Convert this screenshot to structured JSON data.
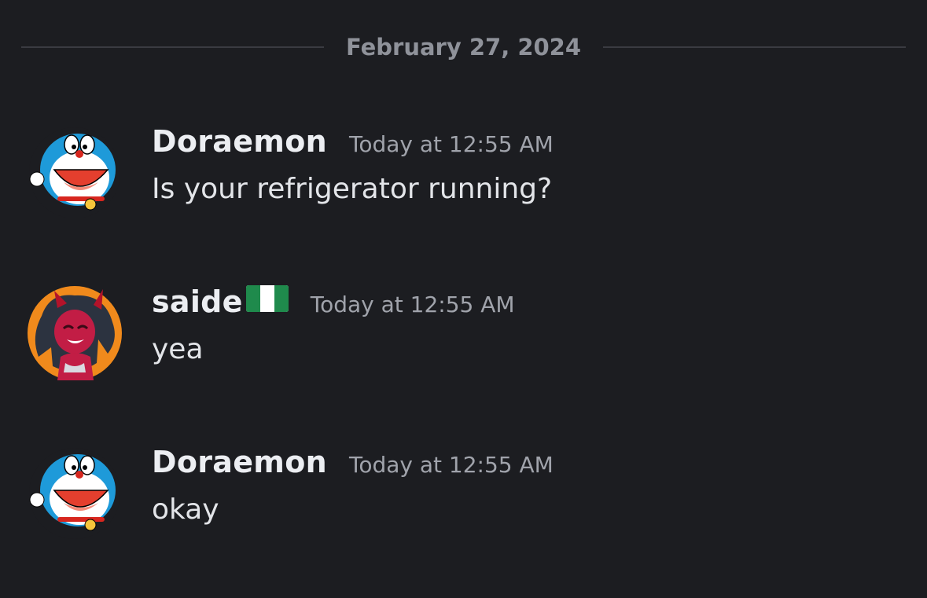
{
  "date_divider": "February 27, 2024",
  "messages": [
    {
      "author": "Doraemon",
      "timestamp": "Today at 12:55 AM",
      "text": "Is your refrigerator running?",
      "avatar_icon": "doraemon-avatar-icon"
    },
    {
      "author": "saide",
      "author_badge": "nigeria-flag-icon",
      "timestamp": "Today at 12:55 AM",
      "text": "yea",
      "avatar_icon": "devil-girl-avatar-icon"
    },
    {
      "author": "Doraemon",
      "timestamp": "Today at 12:55 AM",
      "text": "okay",
      "avatar_icon": "doraemon-avatar-icon"
    }
  ],
  "colors": {
    "background": "#1c1d21",
    "username": "#eceef2",
    "timestamp": "#a0a3ab",
    "message_text": "#e3e5e9",
    "divider_text": "#8f929a",
    "flag_green": "#1f8a4c"
  }
}
